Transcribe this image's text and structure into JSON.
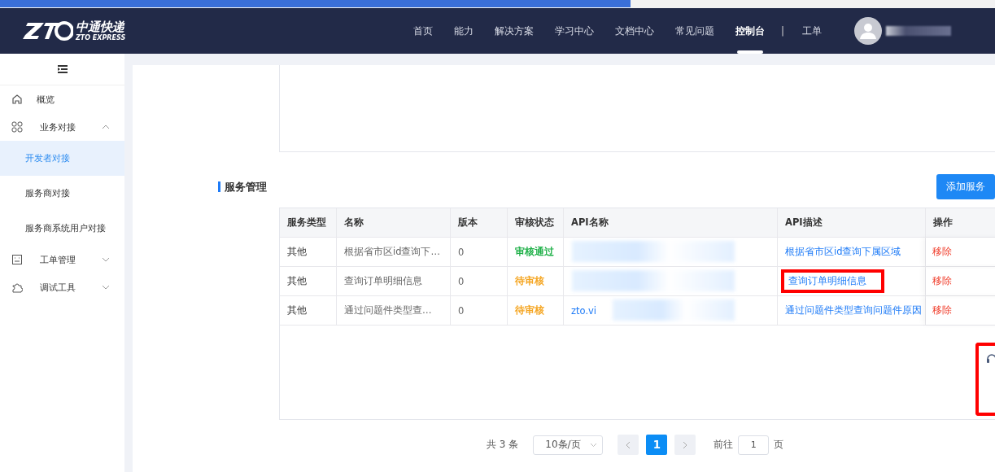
{
  "header": {
    "logo_text": "中通快递",
    "logo_sub": "ZTO EXPRESS",
    "nav": [
      {
        "label": "首页",
        "selected": false
      },
      {
        "label": "能力",
        "selected": false
      },
      {
        "label": "解决方案",
        "selected": false
      },
      {
        "label": "学习中心",
        "selected": false
      },
      {
        "label": "文档中心",
        "selected": false
      },
      {
        "label": "常见问题",
        "selected": false
      },
      {
        "label": "控制台",
        "selected": true
      }
    ],
    "separator": "|",
    "work_order": "工单"
  },
  "sidebar": {
    "items": [
      {
        "label": "概览",
        "kind": "top"
      },
      {
        "label": "业务对接",
        "kind": "group",
        "expanded": true,
        "children": [
          {
            "label": "开发者对接",
            "selected": true
          },
          {
            "label": "服务商对接",
            "selected": false
          },
          {
            "label": "服务商系统用户对接",
            "selected": false
          }
        ]
      },
      {
        "label": "工单管理",
        "kind": "group",
        "expanded": false
      },
      {
        "label": "调试工具",
        "kind": "group",
        "expanded": false
      }
    ]
  },
  "section": {
    "title": "服务管理",
    "add_button": "添加服务"
  },
  "table": {
    "columns": [
      "服务类型",
      "名称",
      "版本",
      "审核状态",
      "API名称",
      "API描述",
      "操作"
    ],
    "rows": [
      {
        "type": "其他",
        "name": "根据省市区id查询下…",
        "version": "0",
        "status": "审核通过",
        "color": "#21b14a",
        "api_name": "",
        "api_desc": "根据省市区id查询下属区域",
        "action": "移除",
        "highlighted": false
      },
      {
        "type": "其他",
        "name": "查询订单明细信息",
        "version": "0",
        "status": "待审核",
        "color": "#f5a623",
        "api_name": "",
        "api_desc": "查询订单明细信息",
        "action": "移除",
        "highlighted": true
      },
      {
        "type": "其他",
        "name": "通过问题件类型查…",
        "version": "0",
        "status": "待审核",
        "color": "#f5a623",
        "api_name": "zto.vi",
        "api_desc": "通过问题件类型查询问题件原因",
        "action": "移除",
        "highlighted": false
      }
    ]
  },
  "pagination": {
    "total": "共 3 条",
    "page_size": "10条/页",
    "pages": [
      {
        "label": "1",
        "selected": true
      }
    ],
    "goto_label": "前往",
    "goto_value": "1",
    "goto_suffix": "页"
  }
}
